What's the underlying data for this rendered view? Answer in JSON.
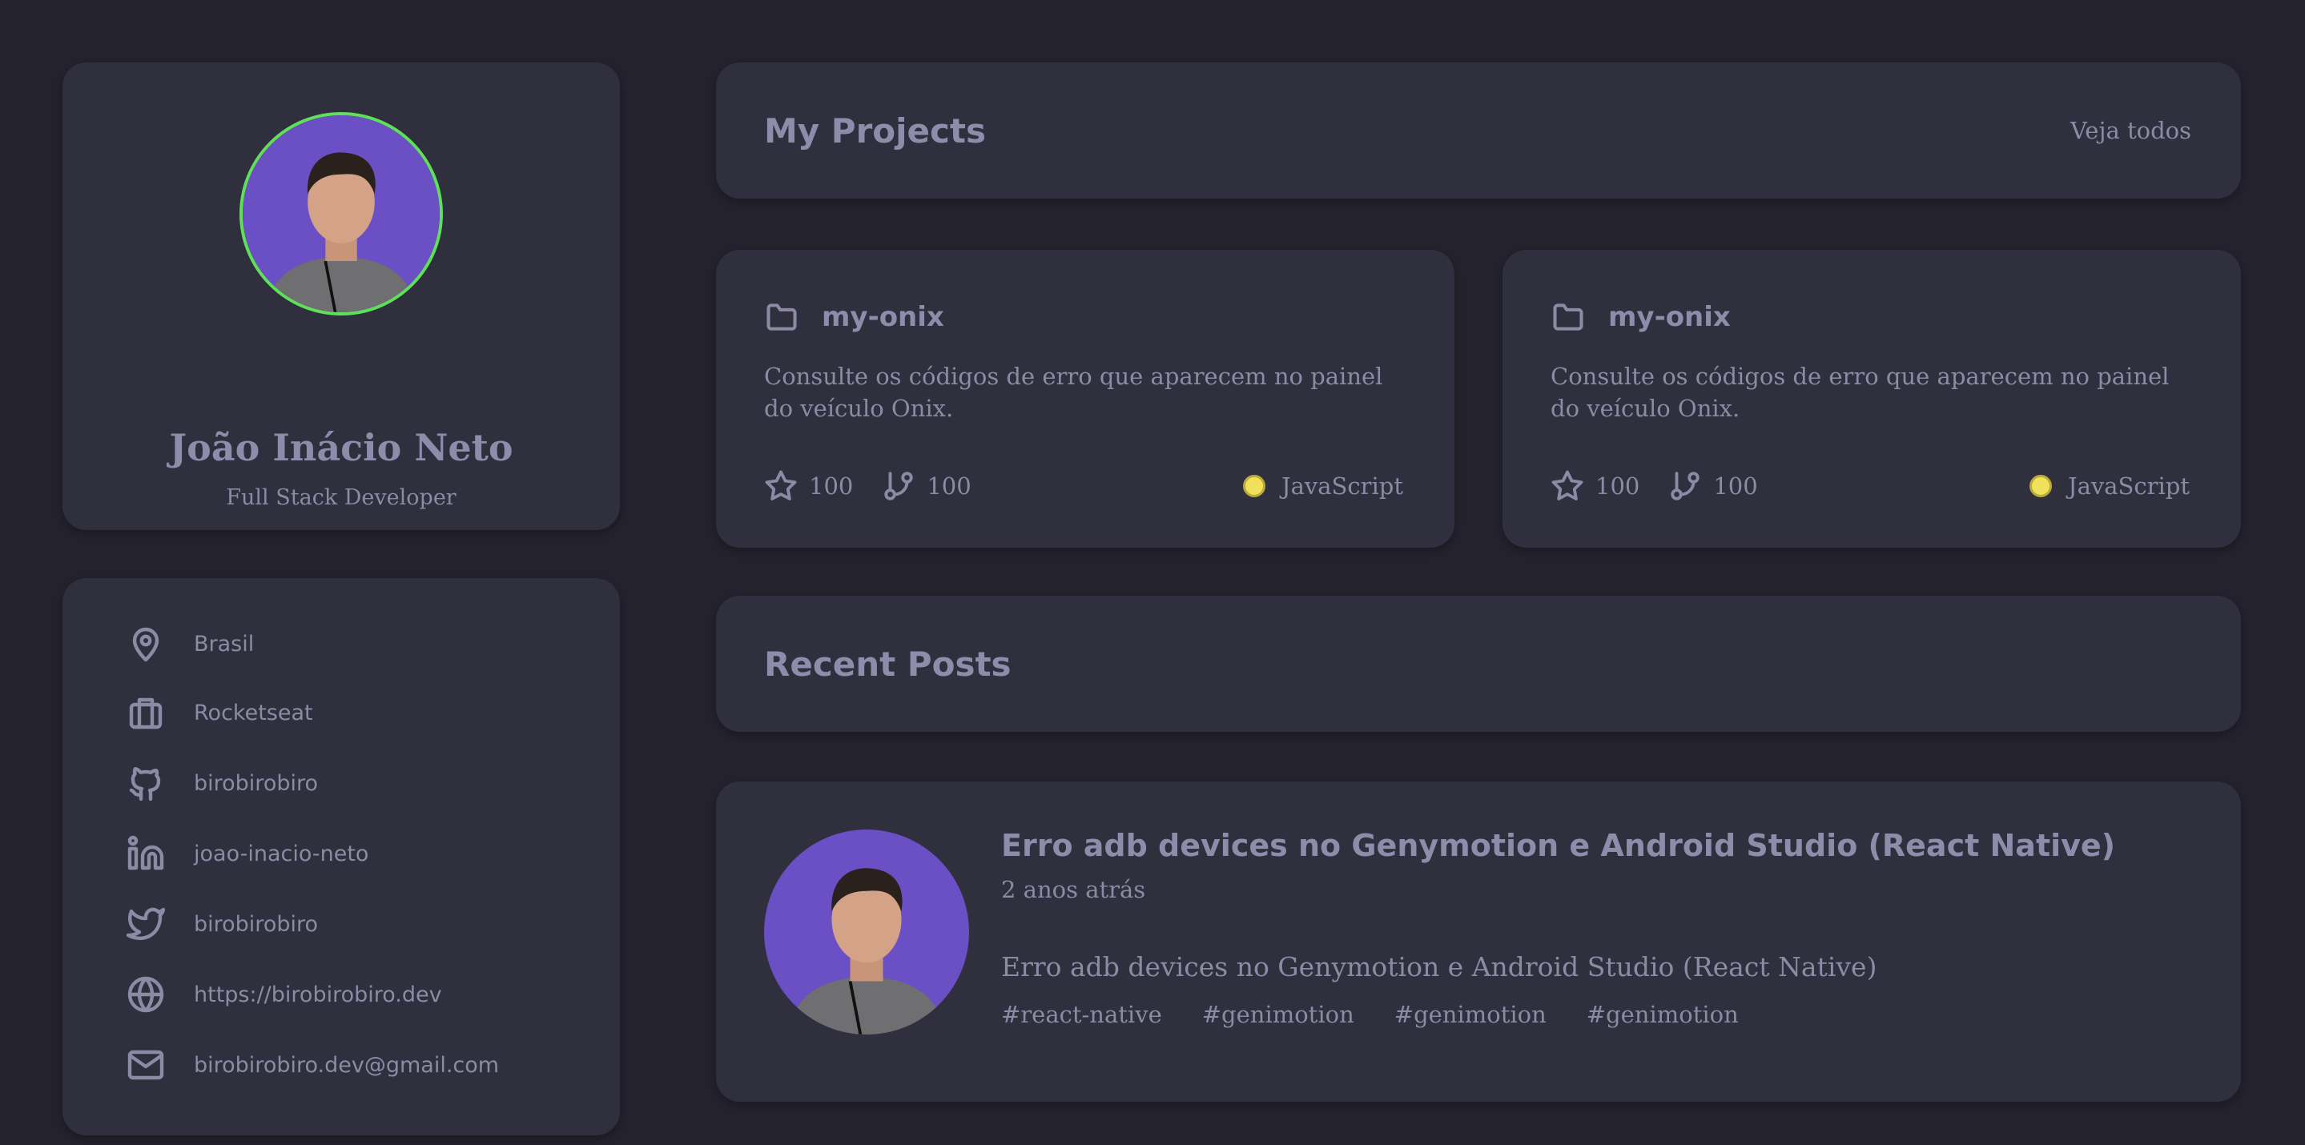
{
  "profile": {
    "name": "João Inácio Neto",
    "role": "Full Stack Developer"
  },
  "contacts": [
    {
      "icon": "map-pin-icon",
      "label": "Brasil"
    },
    {
      "icon": "briefcase-icon",
      "label": "Rocketseat"
    },
    {
      "icon": "github-icon",
      "label": "birobirobiro"
    },
    {
      "icon": "linkedin-icon",
      "label": "joao-inacio-neto"
    },
    {
      "icon": "twitter-icon",
      "label": "birobirobiro"
    },
    {
      "icon": "globe-icon",
      "label": "https://birobirobiro.dev"
    },
    {
      "icon": "mail-icon",
      "label": "birobirobiro.dev@gmail.com"
    }
  ],
  "projects_section": {
    "title": "My Projects",
    "see_all": "Veja todos"
  },
  "projects": [
    {
      "name": "my-onix",
      "description": "Consulte os códigos de erro que aparecem no painel do veículo Onix.",
      "stars": "100",
      "forks": "100",
      "language": "JavaScript",
      "language_color": "#f1e05a"
    },
    {
      "name": "my-onix",
      "description": "Consulte os códigos de erro que aparecem no painel do veículo Onix.",
      "stars": "100",
      "forks": "100",
      "language": "JavaScript",
      "language_color": "#f1e05a"
    }
  ],
  "posts_section": {
    "title": "Recent Posts"
  },
  "post": {
    "title": "Erro adb devices no Genymotion e Android Studio (React Native)",
    "time": "2 anos atrás",
    "excerpt": "Erro adb devices no Genymotion e Android Studio (React Native)",
    "tags": [
      "#react-native",
      "#genimotion",
      "#genimotion",
      "#genimotion"
    ]
  },
  "colors": {
    "background": "#23222d",
    "card": "#302f3d",
    "avatar_ring": "#5ee05a",
    "avatar_bg": "#6b4fc4"
  }
}
